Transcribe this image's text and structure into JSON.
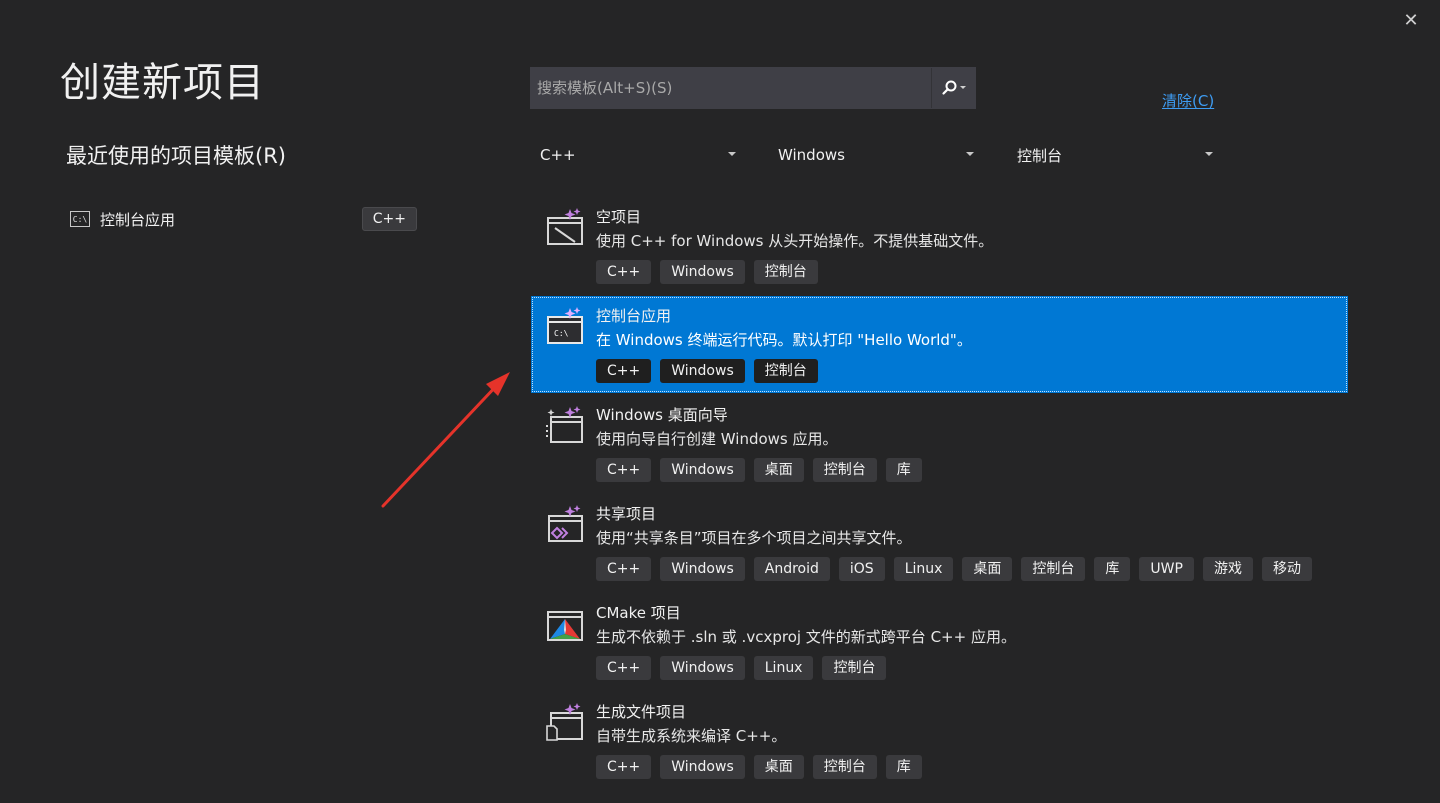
{
  "window": {
    "close_glyph": "✕"
  },
  "page_title": "创建新项目",
  "recent": {
    "heading": "最近使用的项目模板(R)",
    "items": [
      {
        "label": "控制台应用",
        "tag": "C++",
        "icon": "console-app-icon"
      }
    ]
  },
  "search": {
    "placeholder": "搜索模板(Alt+S)(S)",
    "value": ""
  },
  "clear_label": "清除(C)",
  "filters": {
    "language": "C++",
    "platform": "Windows",
    "project_type": "控制台"
  },
  "templates": [
    {
      "name": "空项目",
      "desc": "使用 C++ for Windows 从头开始操作。不提供基础文件。",
      "tags": [
        "C++",
        "Windows",
        "控制台"
      ],
      "selected": false,
      "icon": "empty-project-icon"
    },
    {
      "name": "控制台应用",
      "desc": "在 Windows 终端运行代码。默认打印 \"Hello World\"。",
      "tags": [
        "C++",
        "Windows",
        "控制台"
      ],
      "selected": true,
      "icon": "console-app-icon"
    },
    {
      "name": "Windows 桌面向导",
      "desc": "使用向导自行创建 Windows 应用。",
      "tags": [
        "C++",
        "Windows",
        "桌面",
        "控制台",
        "库"
      ],
      "selected": false,
      "icon": "desktop-wizard-icon"
    },
    {
      "name": "共享项目",
      "desc": "使用“共享条目”项目在多个项目之间共享文件。",
      "tags": [
        "C++",
        "Windows",
        "Android",
        "iOS",
        "Linux",
        "桌面",
        "控制台",
        "库",
        "UWP",
        "游戏",
        "移动"
      ],
      "selected": false,
      "icon": "shared-project-icon"
    },
    {
      "name": "CMake 项目",
      "desc": "生成不依赖于 .sln 或 .vcxproj 文件的新式跨平台 C++ 应用。",
      "tags": [
        "C++",
        "Windows",
        "Linux",
        "控制台"
      ],
      "selected": false,
      "icon": "cmake-icon"
    },
    {
      "name": "生成文件项目",
      "desc": "自带生成系统来编译 C++。",
      "tags": [
        "C++",
        "Windows",
        "桌面",
        "控制台",
        "库"
      ],
      "selected": false,
      "icon": "makefile-project-icon"
    }
  ],
  "colors": {
    "background": "#252526",
    "accent": "#0078d4",
    "link": "#3e9cf2",
    "tag_bg": "#3a3a3d",
    "annotation_arrow": "#e5332a",
    "icon_sparkle": "#c080e0"
  }
}
